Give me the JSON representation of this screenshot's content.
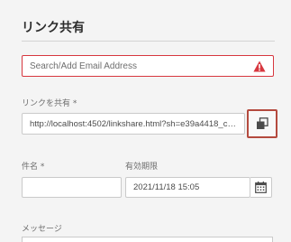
{
  "dialog": {
    "title": "リンク共有"
  },
  "email": {
    "placeholder": "Search/Add Email Address",
    "error_color": "#d7373f",
    "status_icon": "alert-triangle-icon"
  },
  "share_link": {
    "label": "リンクを共有 *",
    "value": "http://localhost:4502/linkshare.html?sh=e39a4418_c4f5....",
    "copy_icon": "copy-icon"
  },
  "subject": {
    "label": "件名 *",
    "value": ""
  },
  "expiration": {
    "label": "有効期限",
    "value": "2021/11/18 15:05",
    "calendar_icon": "calendar-icon"
  },
  "message": {
    "label": "メッセージ"
  }
}
